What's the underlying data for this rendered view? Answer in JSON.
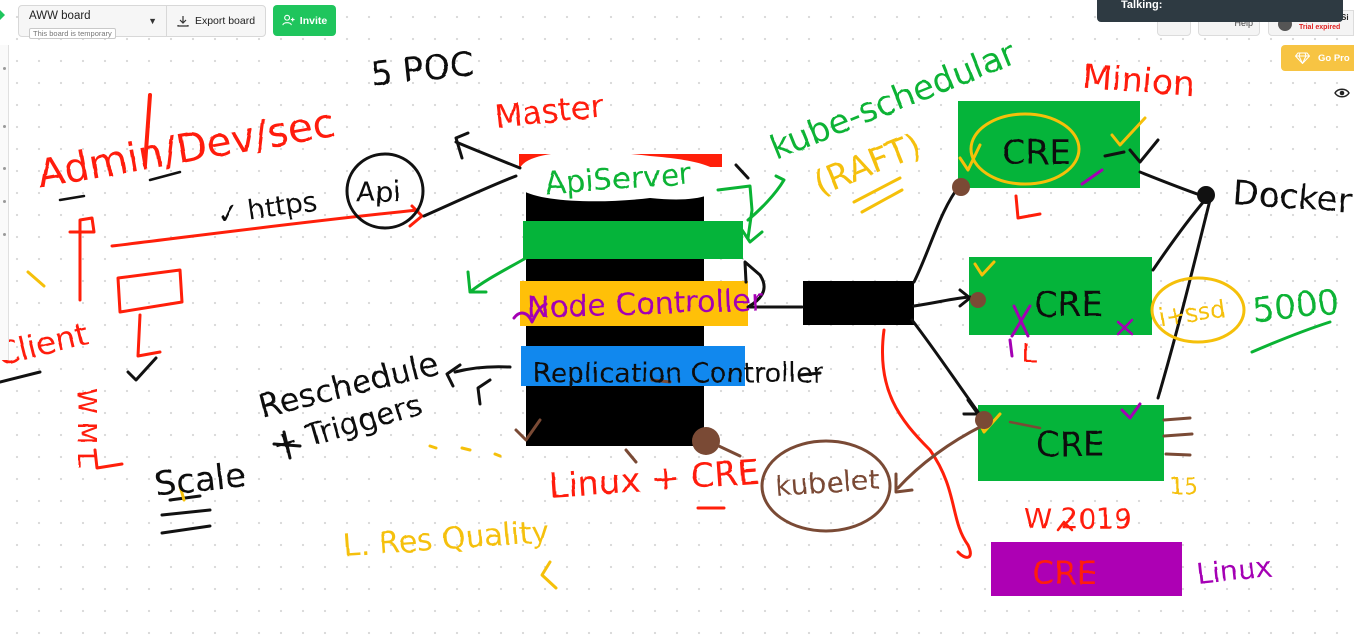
{
  "toolbar": {
    "board_name": "AWW board",
    "temporary_note": "This board is temporary",
    "export_label": "Export board",
    "invite_label": "Invite"
  },
  "top_right": {
    "talking_label": "Talking:",
    "help_label": "Help",
    "user_name": "Si",
    "trial_status": "Trial expired",
    "go_pro_label": "Go Pro"
  },
  "colors": {
    "accent_green": "#1fc55d",
    "go_pro_yellow": "#f7c443",
    "trial_red": "#e02020",
    "ink_black": "#111111",
    "ink_red": "#ff1f0a",
    "ink_green": "#0ab334",
    "ink_yellow": "#f5c00a",
    "ink_purple": "#a400b4",
    "ink_brown": "#7a4a35",
    "box_green": "#05b43a",
    "box_yellow": "#ffc008",
    "box_blue": "#1188ee",
    "box_purple": "#ad00b4"
  },
  "sketch": {
    "poc": "5 POC",
    "master": "Master",
    "admin": "Admin/Dev/sec",
    "https": "✓ https",
    "api": "Api",
    "client": "Client",
    "wm": "W M L",
    "api_server": "ApiServer",
    "node_controller": "Node Controller",
    "replication_controller": "Replication Controller",
    "reschedule": "Reschedule",
    "triggers": "+ Triggers",
    "scale": "Scale",
    "res_quality": "L. Res Quality",
    "linux_cre": "Linux + CRE",
    "kubelet": "kubelet",
    "kubescheduler": "kube-schedular",
    "raft": "(RAFT)",
    "minion": "Minion",
    "cre": "CRE",
    "docker": "Docker",
    "ssd": "i+ssd",
    "count_5000": "5000",
    "w2019": "W 2019",
    "linux_label": "Linux",
    "small_l": "L",
    "small_15": "15"
  }
}
